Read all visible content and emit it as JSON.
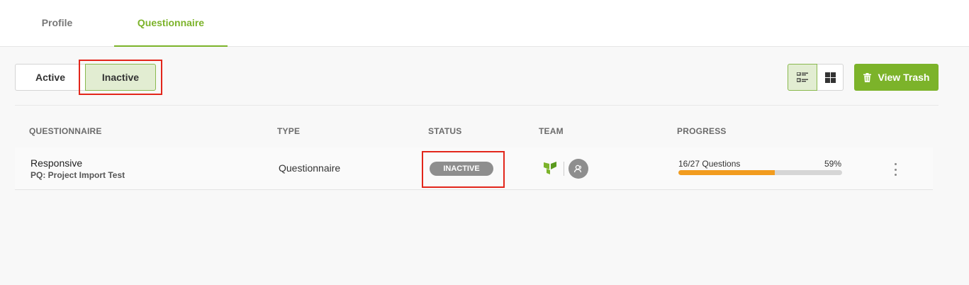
{
  "tabs": [
    {
      "label": "Profile",
      "selected": false
    },
    {
      "label": "Questionnaire",
      "selected": true
    }
  ],
  "filter": {
    "active_label": "Active",
    "inactive_label": "Inactive",
    "selected": "Inactive"
  },
  "view": {
    "list_icon": "list-view-icon",
    "grid_icon": "grid-view-icon",
    "selected": "list"
  },
  "trash_button": {
    "label": "View Trash",
    "icon": "trash-icon"
  },
  "table": {
    "columns": [
      "QUESTIONNAIRE",
      "TYPE",
      "STATUS",
      "TEAM",
      "PROGRESS"
    ],
    "rows": [
      {
        "title": "Responsive",
        "subtitle": "PQ: Project Import Test",
        "type": "Questionnaire",
        "status": "INACTIVE",
        "progress_text": "16/27 Questions",
        "progress_percent_label": "59%",
        "progress_fraction": 0.59
      }
    ]
  },
  "colors": {
    "accent": "#7cb32a",
    "accent_light": "#e2edd2",
    "progress": "#f29c1f",
    "status_inactive": "#8e8e8e",
    "highlight": "#e2261b"
  }
}
